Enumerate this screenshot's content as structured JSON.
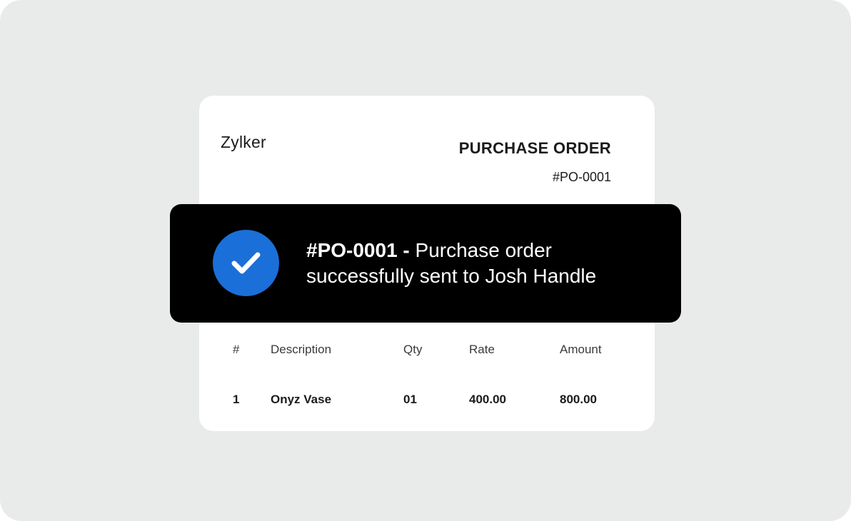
{
  "purchase_order": {
    "brand": "Zylker",
    "title": "PURCHASE ORDER",
    "number": "#PO-0001",
    "table": {
      "headers": [
        "#",
        "Description",
        "Qty",
        "Rate",
        "Amount"
      ],
      "rows": [
        [
          "1",
          "Onyz Vase",
          "01",
          "400.00",
          "800.00"
        ]
      ]
    }
  },
  "toast": {
    "icon": "check-circle-icon",
    "po_number": "#PO-0001",
    "separator": " - ",
    "message": "Purchase order successfully sent to Josh Handle",
    "icon_color": "#1b6fd8",
    "background": "#000000"
  }
}
